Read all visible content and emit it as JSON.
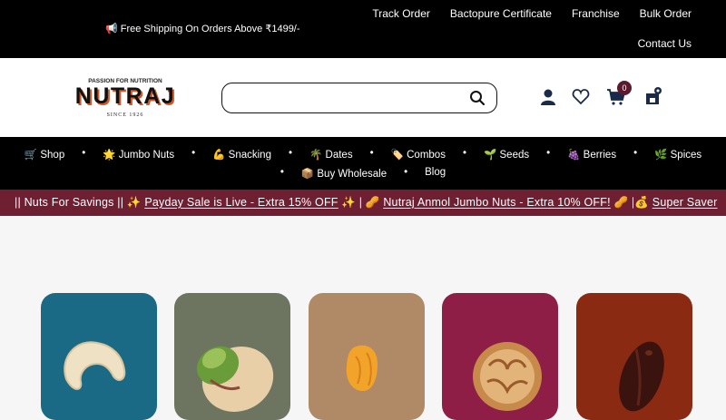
{
  "topbar": {
    "announcement": "📢 Free Shipping On Orders Above ₹1499/-",
    "links": [
      "Track Order",
      "Bactopure Certificate",
      "Franchise",
      "Bulk Order"
    ],
    "contact": "Contact Us"
  },
  "header": {
    "logo_tagline": "PASSION FOR NUTRITION",
    "logo_name": "NUTRAJ",
    "logo_since": "SINCE 1926",
    "search_placeholder": "",
    "cart_count": "0"
  },
  "nav": {
    "row1": [
      "🛒 Shop",
      "🌟 Jumbo Nuts",
      "💪 Snacking",
      "🌴 Dates",
      "🏷️ Combos",
      "🌱 Seeds",
      "🍇 Berries",
      "🌿 Spices"
    ],
    "row2": [
      "📦 Buy Wholesale",
      "Blog"
    ]
  },
  "ticker": {
    "prefix": "|| Nuts For Savings || ✨ ",
    "item1": "Payday Sale is Live - Extra 15% OFF",
    "sep1": " ✨ | 🥜 ",
    "item2": "Nutraj Anmol Jumbo Nuts - Extra 10% OFF!",
    "sep2": " 🥜 |💰 ",
    "item3": "Super Saver"
  },
  "cards": [
    {
      "name": "cashew",
      "bg": "#1a6a86"
    },
    {
      "name": "pistachio",
      "bg": "#6d7560"
    },
    {
      "name": "apricot",
      "bg": "#b08a66"
    },
    {
      "name": "walnut",
      "bg": "#8e1e45"
    },
    {
      "name": "dates",
      "bg": "#8a2a12"
    }
  ],
  "colors": {
    "accent": "#6e1f32",
    "badge": "#5b1a2e"
  }
}
